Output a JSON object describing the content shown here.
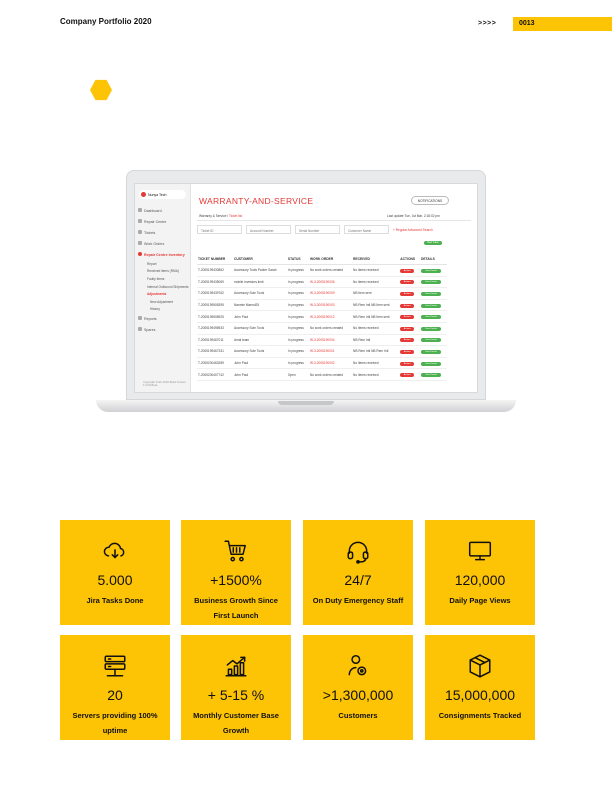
{
  "header": {
    "title": "Company Portfolio 2020",
    "arrows": ">>>>",
    "page_number": "0013"
  },
  "colors": {
    "accent": "#fdc305",
    "app_red": "#e53935",
    "app_green": "#4caf50"
  },
  "app": {
    "brand": "Nunya Tech",
    "title": "WARRANTY-AND-SERVICE",
    "notifications_label": "NOTIFICATIONS",
    "breadcrumb_root": "Warranty & Service",
    "breadcrumb_current": "Ticket list",
    "last_update": "Last update Tue, 1st Mar, 2:18:02 pm",
    "sidebar": {
      "items": [
        "Dashboard",
        "Repair Centre",
        "Tickets",
        "Work Orders"
      ],
      "active": "Repair Centre Inventory",
      "sub_items": [
        "Report",
        "Received items (RMA)",
        "Faulty Items",
        "Internal Outbound Shipments",
        "Adjustments",
        "New Adjustment",
        "History"
      ],
      "bottom_items": [
        "Reports",
        "Spares"
      ],
      "copyright": "Copyright Jirah 2020 Build Version 1.6.09 Beta"
    },
    "filters": [
      "Ticket ID",
      "Account Number",
      "Serial Number",
      "Customer Name"
    ],
    "advanced_search": "+ Regular Advanced Search",
    "new_case": "New Case",
    "table": {
      "headers": [
        "TICKET NUMBER",
        "CUSTOMER",
        "STATUS",
        "WORK ORDER",
        "RECEIVED",
        "ACTIONS",
        "DETAILS"
      ],
      "action_label": "Actions",
      "details_label": "View Details",
      "rows": [
        [
          "T-2005199430862",
          "Accessory Tools Parker Sarah",
          "In progress",
          "No work orders created",
          "No items received"
        ],
        [
          "T-2005199435069",
          "mobile investors.limit",
          "In progress",
          "W-3-2005190006",
          "No items received"
        ],
        [
          "T-2005199439762",
          "Accessory Sole Tools",
          "In progress",
          "W-3-2005190009",
          "NB Item sent"
        ],
        [
          "T-2005199508395",
          "Nanmie Maend25",
          "In progress",
          "W-3-2005190003",
          "NB Rem Intl NB Item sent"
        ],
        [
          "T-2005199508925",
          "John Paul",
          "In progress",
          "W-3-2005190012",
          "NB Rem Intl NB Item sent"
        ],
        [
          "T-2005199498933",
          "Accessory Sole Tools",
          "In progress",
          "No work orders created",
          "No items received"
        ],
        [
          "T-2005199467011",
          "Amal team",
          "In progress",
          "W-3-2005190004",
          "NB Rem Intl"
        ],
        [
          "T-2005199467331",
          "Accessory Sole Tools",
          "In progress",
          "W-3-2005190001",
          "NB Rem Intl NB Rem Intl"
        ],
        [
          "T-2005200463289",
          "John Paul",
          "In progress",
          "W-3-2005190002",
          "No items received"
        ],
        [
          "T-2005200407742",
          "John Paul",
          "Open",
          "No work orders created",
          "No items received"
        ]
      ]
    }
  },
  "stats": [
    {
      "icon": "cloud-download-icon",
      "value": "5.000",
      "label": "Jira Tasks Done"
    },
    {
      "icon": "shopping-cart-icon",
      "value": "+1500%",
      "label": "Business Growth Since First Launch"
    },
    {
      "icon": "headset-icon",
      "value": "24/7",
      "label": "On Duty Emergency Staff"
    },
    {
      "icon": "monitor-icon",
      "value": "120,000",
      "label": "Daily Page Views"
    },
    {
      "icon": "server-icon",
      "value": "20",
      "label": "Servers providing 100% uptime"
    },
    {
      "icon": "growth-chart-icon",
      "value": "+ 5-15 %",
      "label": "Monthly Customer Base Growth"
    },
    {
      "icon": "user-settings-icon",
      "value": ">1,300,000",
      "label": "Customers"
    },
    {
      "icon": "package-icon",
      "value": "15,000,000",
      "label": "Consignments Tracked"
    }
  ]
}
